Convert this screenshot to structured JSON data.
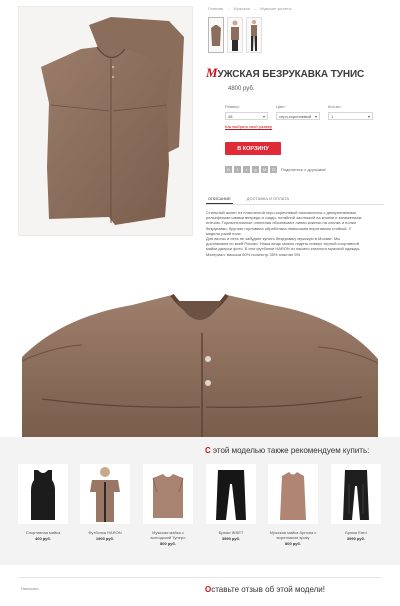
{
  "breadcrumb": [
    "Главная",
    "→",
    "Мужская",
    "→",
    "Мужские жилеты"
  ],
  "thumbnails": [
    "vest-front",
    "model-front",
    "model-full"
  ],
  "product": {
    "title_first": "М",
    "title_rest": "ужская безрукавка тунис",
    "price": "4800 руб."
  },
  "options": {
    "size_label": "Размер:",
    "size_value": "48",
    "color_label": "Цвет:",
    "color_value": "серо-коричневый",
    "qty_label": "Кол-во:",
    "qty_value": "1",
    "size_help": "Как выбрать свой размер"
  },
  "cart_button": "В КОРЗИНУ",
  "share": {
    "icons": [
      "В",
      "f",
      "t",
      "g",
      "М",
      "О"
    ],
    "text": "Поделитесь с друзьями!"
  },
  "tabs": [
    "ОПИСАНИЕ",
    "ДОСТАВКА И ОПЛАТА"
  ],
  "description": [
    "Стильный жилет из пластичной серо-коричневой полиэкосоты с декоративными",
    "рельефными швами впереди и сзади, потайной застежкой на кнопки и занижением",
    "плечом. Горизонтальные членения обозначают линии кокетки на спинке и полки",
    "безрукавки. Круглая горловина обработана невысоким воротником стойкой. У",
    "модели узкий пояс.",
    "Для весны и лета не забудьте купить безрукавку мужскую в Москве. Мы",
    "доставляем по всей России. Наша вещь можно надеть поверх черной спортивной",
    "майки джерси фото. Б или футболки HARON из нашего каталога мужской одежды.",
    "Материал: вискоза 60% полиэстр 35% эластан 5%"
  ],
  "recommendations": {
    "title_first": "С",
    "title_rest": " этой моделью также рекомендуем купить:",
    "items": [
      {
        "name": "Спортивная майка",
        "price": "400 руб."
      },
      {
        "name": "Футболка HARON",
        "price": "1900 руб."
      },
      {
        "name": "Мужская майка с вогнодской Тунеро",
        "price": "800 руб."
      },
      {
        "name": "Брюки INSET",
        "price": "3990 руб."
      },
      {
        "name": "Мужская майка Арнона с воротником эрику",
        "price": "800 руб."
      },
      {
        "name": "Брюки Eard",
        "price": "3990 руб."
      }
    ]
  },
  "footer": {
    "write_link": "Написать",
    "review_first": "О",
    "review_rest": "ставьте отзыв об этой модели!"
  },
  "colors": {
    "accent": "#c5161d",
    "button": "#e02a36",
    "garment": "#8b6e5c"
  }
}
